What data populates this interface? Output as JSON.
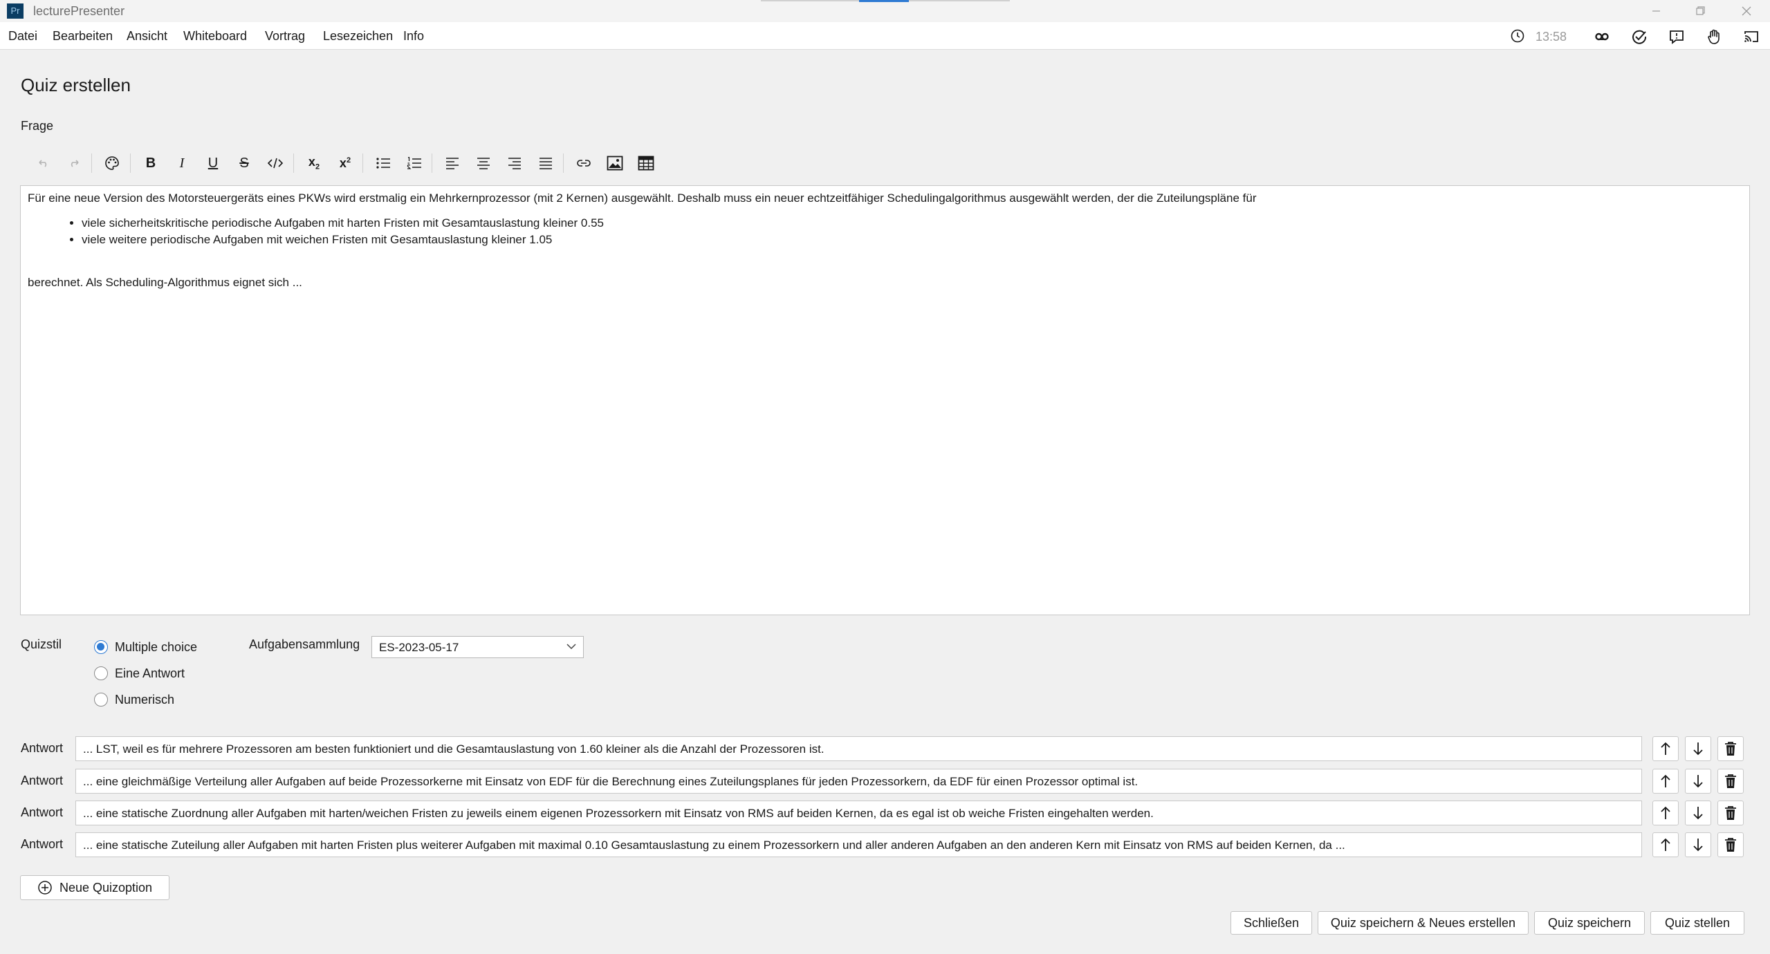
{
  "window": {
    "title": "lecturePresenter",
    "icon_text": "Pr"
  },
  "menu": {
    "items": [
      "Datei",
      "Bearbeiten",
      "Ansicht",
      "Whiteboard",
      "Vortrag",
      "Lesezeichen",
      "Info"
    ],
    "time": "13:58",
    "right_icons": [
      "clock-icon",
      "recording-icon",
      "check-circle-icon",
      "chat-icon",
      "hand-icon",
      "cast-icon"
    ]
  },
  "page": {
    "title": "Quiz erstellen",
    "question_label": "Frage"
  },
  "toolbar": {
    "icons": [
      "undo-icon",
      "redo-icon",
      "palette-icon",
      "bold-icon",
      "italic-icon",
      "underline-icon",
      "strikethrough-icon",
      "code-icon",
      "subscript-icon",
      "superscript-icon",
      "bullet-list-icon",
      "numbered-list-icon",
      "align-left-icon",
      "align-center-icon",
      "align-right-icon",
      "align-justify-icon",
      "link-icon",
      "image-icon",
      "table-icon"
    ]
  },
  "question": {
    "intro": "Für eine neue Version des Motorsteuergeräts eines PKWs wird erstmalig ein Mehrkernprozessor (mit 2 Kernen) ausgewählt. Deshalb muss ein neuer echtzeitfähiger Schedulingalgorithmus ausgewählt werden, der die Zuteilungspläne für",
    "bullets": [
      "viele sicherheitskritische periodische Aufgaben mit harten Fristen mit Gesamtauslastung kleiner 0.55",
      "viele weitere periodische Aufgaben mit weichen Fristen mit Gesamtauslastung kleiner 1.05"
    ],
    "outro": "berechnet. Als Scheduling-Algorithmus eignet sich ..."
  },
  "quiz_style": {
    "label": "Quizstil",
    "options": [
      "Multiple choice",
      "Eine Antwort",
      "Numerisch"
    ],
    "selected": "Multiple choice"
  },
  "collection": {
    "label": "Aufgabensammlung",
    "value": "ES-2023-05-17"
  },
  "answers": {
    "label": "Antwort",
    "items": [
      "... LST, weil es für mehrere Prozessoren am besten funktioniert und die Gesamtauslastung von 1.60 kleiner als die Anzahl der Prozessoren ist.",
      "... eine gleichmäßige Verteilung aller Aufgaben auf beide Prozessorkerne mit Einsatz von EDF für die Berechnung eines Zuteilungsplanes für jeden Prozessorkern, da EDF für einen Prozessor optimal ist.",
      "... eine statische Zuordnung aller Aufgaben mit harten/weichen Fristen zu jeweils einem eigenen Prozessorkern mit Einsatz von RMS auf beiden Kernen, da es egal ist ob weiche Fristen eingehalten werden.",
      "... eine statische Zuteilung aller Aufgaben mit harten Fristen plus weiterer Aufgaben mit maximal 0.10 Gesamtauslastung zu einem Prozessorkern und aller anderen Aufgaben an den anderen Kern mit Einsatz von RMS auf beiden Kernen, da ..."
    ]
  },
  "buttons": {
    "new_option": "Neue Quizoption",
    "close": "Schließen",
    "save_new": "Quiz speichern & Neues erstellen",
    "save": "Quiz speichern",
    "start": "Quiz stellen"
  }
}
